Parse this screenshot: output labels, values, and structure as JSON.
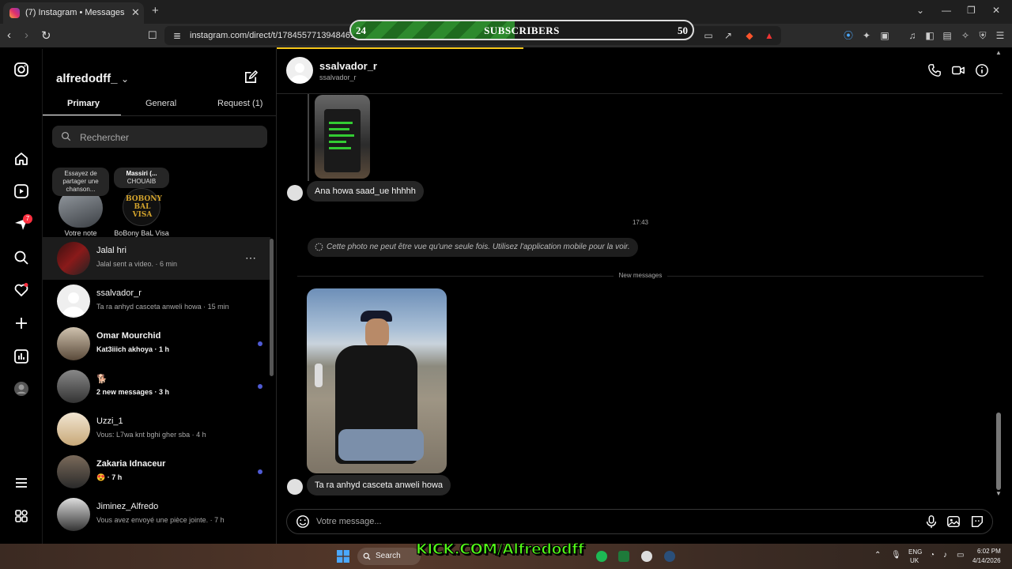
{
  "browser": {
    "tab_title": "(7) Instagram • Messages",
    "tab_close": "✕",
    "new_tab": "+",
    "url": "instagram.com/direct/t/1784557713948461"
  },
  "overlay": {
    "subscribers_current": "24",
    "subscribers_label": "SUBSCRIBERS",
    "subscribers_goal": "50",
    "progress_fraction": 0.48,
    "kick_text": "KICK.COM/Alfredodff"
  },
  "rail": {
    "notifications_badge": "7"
  },
  "inbox": {
    "username": "alfredodff_",
    "tabs": [
      "Primary",
      "General",
      "Request (1)"
    ],
    "search_placeholder": "Rechercher",
    "notes": [
      {
        "bubble": "Essayez de partager une chanson...",
        "label": "Votre note"
      },
      {
        "bubble_title": "Massiri (...",
        "bubble_sub": "CHOUAIB",
        "label": "BoBony BaL Visa"
      }
    ],
    "conversations": [
      {
        "name": "Jalal hri",
        "preview": "Jalal sent a video. · 6 min",
        "bold": false,
        "unread": false,
        "active": true
      },
      {
        "name": "ssalvador_r",
        "preview": "Ta ra anhyd casceta anweli howa · 15 min",
        "bold": false,
        "unread": false,
        "active": false
      },
      {
        "name": "Omar Mourchid",
        "preview": "Kat3iiich akhoya · 1 h",
        "bold": true,
        "unread": true,
        "active": false
      },
      {
        "name": "🐕",
        "preview": "2 new messages · 3 h",
        "bold": true,
        "unread": true,
        "active": false
      },
      {
        "name": "Uzzi_1",
        "preview": "Vous: L7wa knt bghi gher sba · 4 h",
        "bold": false,
        "unread": false,
        "active": false
      },
      {
        "name": "Zakaria Idnaceur",
        "preview": "😍 · 7 h",
        "bold": true,
        "unread": true,
        "active": false
      },
      {
        "name": "Jiminez_Alfredo",
        "preview": "Vous avez envoyé une pièce jointe. · 7 h",
        "bold": false,
        "unread": false,
        "active": false
      }
    ]
  },
  "chat": {
    "name": "ssalvador_r",
    "handle": "ssalvador_r",
    "messages": {
      "first": "Ana howa saad_ue hhhhh",
      "timestamp": "17:43",
      "view_once": "Cette photo ne peut être vue qu'une seule fois. Utilisez l'application mobile pour la voir.",
      "divider": "New messages",
      "last": "Ta ra anhyd casceta anweli howa"
    },
    "composer_placeholder": "Votre message..."
  },
  "taskbar": {
    "search": "Search",
    "lang1": "ENG",
    "lang2": "UK",
    "time": "6:02 PM",
    "date": "4/14/2026"
  }
}
